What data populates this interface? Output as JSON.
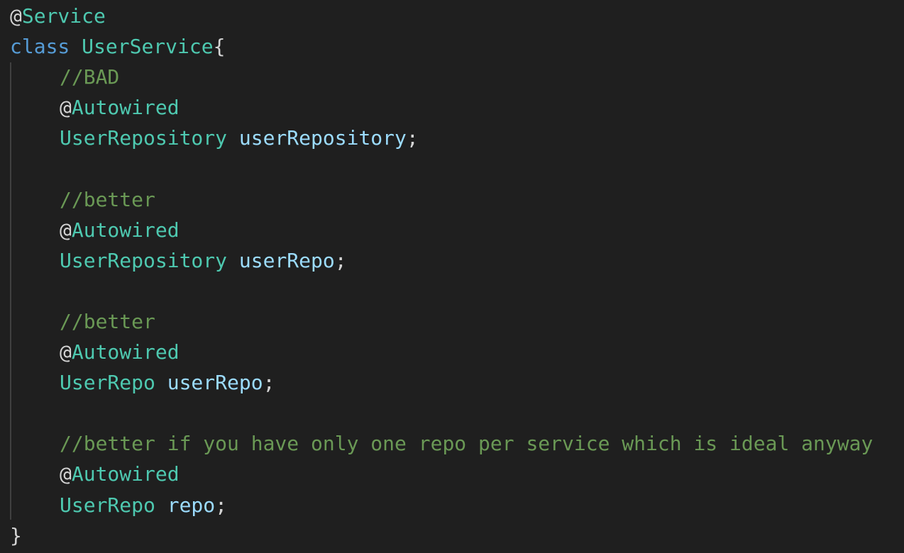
{
  "code": {
    "line1": {
      "at": "@",
      "annotation": "Service"
    },
    "line2": {
      "keyword": "class",
      "class_name": "UserService",
      "brace": "{"
    },
    "line3": {
      "comment": "//BAD"
    },
    "line4": {
      "at": "@",
      "annotation": "Autowired"
    },
    "line5": {
      "type": "UserRepository",
      "variable": "userRepository",
      "semicolon": ";"
    },
    "line7": {
      "comment": "//better"
    },
    "line8": {
      "at": "@",
      "annotation": "Autowired"
    },
    "line9": {
      "type": "UserRepository",
      "variable": "userRepo",
      "semicolon": ";"
    },
    "line11": {
      "comment": "//better"
    },
    "line12": {
      "at": "@",
      "annotation": "Autowired"
    },
    "line13": {
      "type": "UserRepo",
      "variable": "userRepo",
      "semicolon": ";"
    },
    "line15": {
      "comment": "//better if you have only one repo per service which is ideal anyway"
    },
    "line16": {
      "at": "@",
      "annotation": "Autowired"
    },
    "line17": {
      "type": "UserRepo",
      "variable": "repo",
      "semicolon": ";"
    },
    "line18": {
      "brace": "}"
    }
  },
  "colors": {
    "background": "#1f1f1f",
    "annotation": "#4ec9b0",
    "keyword": "#569cd6",
    "variable": "#9cdcfe",
    "comment": "#6a9955",
    "punctuation": "#d4d4d4"
  }
}
